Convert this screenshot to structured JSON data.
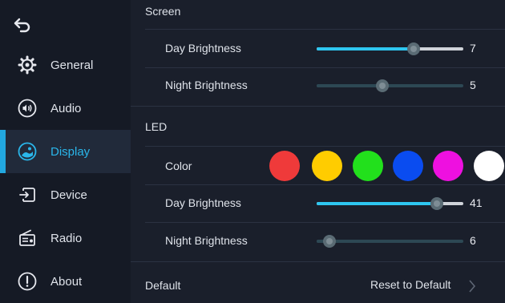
{
  "sidebar": {
    "items": [
      {
        "label": "General",
        "icon": "gear-icon"
      },
      {
        "label": "Audio",
        "icon": "speaker-icon"
      },
      {
        "label": "Display",
        "icon": "display-icon",
        "active": true
      },
      {
        "label": "Device",
        "icon": "device-icon"
      },
      {
        "label": "Radio",
        "icon": "radio-icon"
      },
      {
        "label": "About",
        "icon": "info-icon"
      }
    ]
  },
  "screen": {
    "title": "Screen",
    "day": {
      "label": "Day Brightness",
      "value": "7",
      "fraction": 0.66
    },
    "night": {
      "label": "Night Brightness",
      "value": "5",
      "fraction": 0.45,
      "disabled": true
    }
  },
  "led": {
    "title": "LED",
    "color_label": "Color",
    "colors": [
      "#ef3a3a",
      "#ffcc00",
      "#22e01c",
      "#0a4cf0",
      "#ee10e0",
      "#ffffff"
    ],
    "day": {
      "label": "Day Brightness",
      "value": "41",
      "fraction": 0.82
    },
    "night": {
      "label": "Night Brightness",
      "value": "6",
      "fraction": 0.09,
      "disabled": true
    }
  },
  "footer": {
    "label": "Default",
    "reset_label": "Reset to Default"
  },
  "accent": "#2ec6f0"
}
